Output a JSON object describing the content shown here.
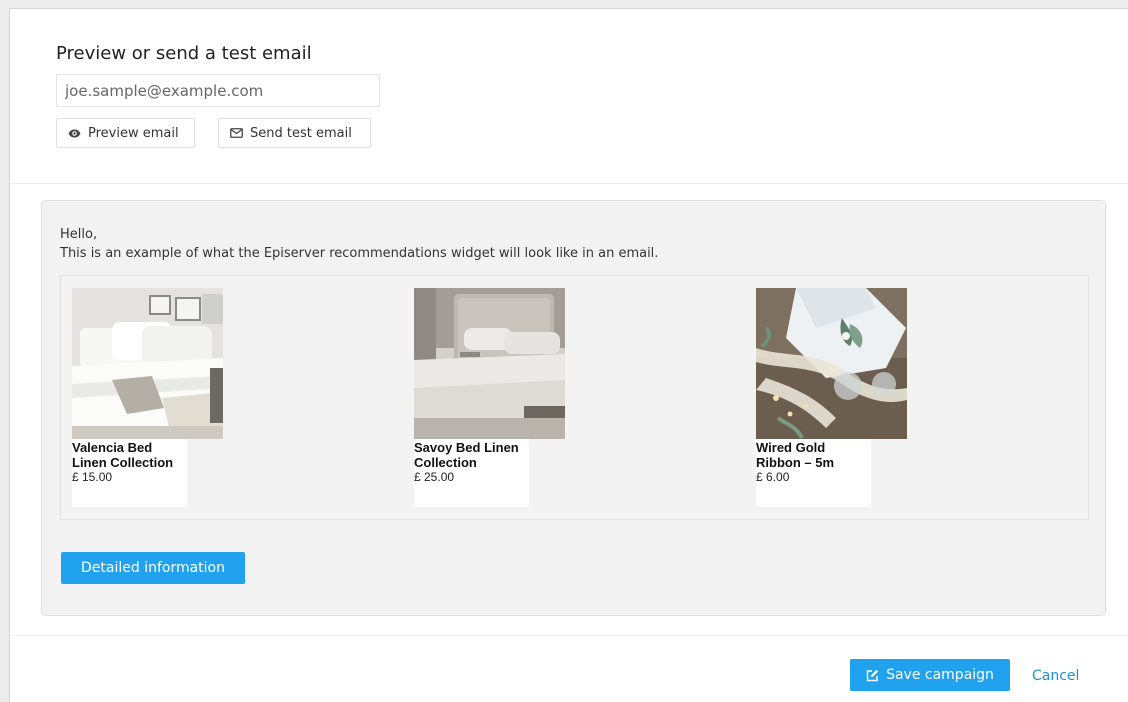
{
  "test_email": {
    "title": "Preview or send a test email",
    "email_value": "joe.sample@example.com",
    "preview_button": "Preview email",
    "send_button": "Send test email"
  },
  "preview": {
    "greeting": "Hello,",
    "intro": "This is an example of what the Episerver recommendations widget will look like in an email.",
    "products": [
      {
        "name": "Valencia Bed Linen Collection",
        "price": "£ 15.00"
      },
      {
        "name": "Savoy Bed Linen Collection",
        "price": "£ 25.00"
      },
      {
        "name": "Wired Gold Ribbon – 5m",
        "price": "£ 6.00"
      }
    ],
    "detail_button": "Detailed information"
  },
  "footer": {
    "save_button": "Save campaign",
    "cancel_link": "Cancel"
  },
  "colors": {
    "primary": "#20a2ef",
    "link": "#1f8fd6",
    "preview_background": "#f2f2f2"
  },
  "icons": {
    "preview": "eye-icon",
    "send": "envelope-icon",
    "save": "edit-icon"
  }
}
